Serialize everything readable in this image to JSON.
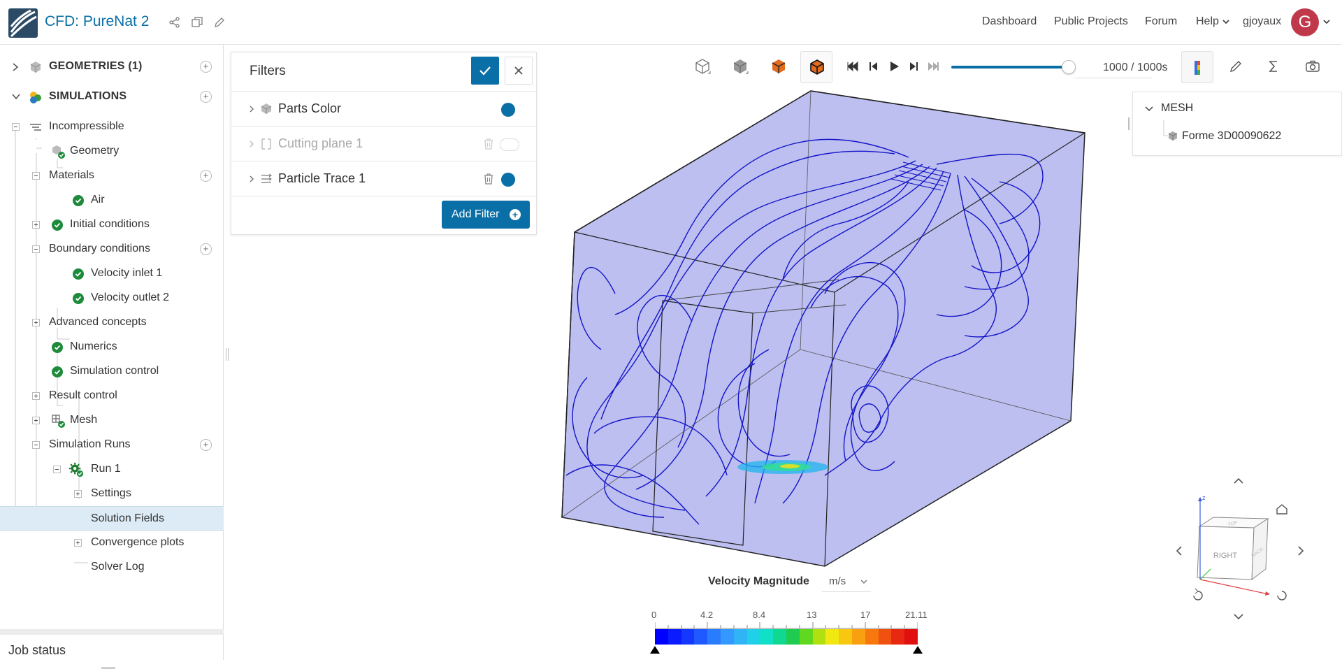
{
  "app": {
    "title": "CFD: PureNat 2",
    "nav": [
      "Dashboard",
      "Public Projects",
      "Forum",
      "Help",
      "gjoyaux"
    ],
    "avatar_letter": "G",
    "accent_color": "#0a6fa6"
  },
  "tree": {
    "geometries": "GEOMETRIES (1)",
    "simulations": "SIMULATIONS",
    "items": [
      {
        "label": "Incompressible"
      },
      {
        "label": "Geometry"
      },
      {
        "label": "Materials"
      },
      {
        "label": "Air"
      },
      {
        "label": "Initial conditions"
      },
      {
        "label": "Boundary conditions"
      },
      {
        "label": "Velocity inlet 1"
      },
      {
        "label": "Velocity outlet 2"
      },
      {
        "label": "Advanced concepts"
      },
      {
        "label": "Numerics"
      },
      {
        "label": "Simulation control"
      },
      {
        "label": "Result control"
      },
      {
        "label": "Mesh"
      },
      {
        "label": "Simulation Runs"
      },
      {
        "label": "Run 1"
      },
      {
        "label": "Settings"
      },
      {
        "label": "Solution Fields"
      },
      {
        "label": "Convergence plots"
      },
      {
        "label": "Solver Log"
      }
    ],
    "selected": "Solution Fields"
  },
  "job_status": "Job status",
  "filters": {
    "title": "Filters",
    "rows": [
      {
        "label": "Parts Color",
        "enabled": true
      },
      {
        "label": "Cutting plane 1",
        "enabled": false
      },
      {
        "label": "Particle Trace 1",
        "enabled": true
      }
    ],
    "add_label": "Add Filter"
  },
  "toolbar": {
    "time_readout": "1000 / 1000s",
    "time_progress": 0.98
  },
  "mesh_panel": {
    "title": "MESH",
    "item": "Forme 3D00090622"
  },
  "legend": {
    "label": "Velocity Magnitude",
    "unit": "m/s",
    "ticks": [
      "0",
      "4.2",
      "8.4",
      "13",
      "17",
      "21.11"
    ],
    "colors": [
      "#0000ff",
      "#0a1cff",
      "#1438ff",
      "#1e5aff",
      "#2a7cff",
      "#3398ff",
      "#30b4f5",
      "#20d0e8",
      "#10e0c8",
      "#10d890",
      "#20cc50",
      "#60d820",
      "#b0e010",
      "#f0e810",
      "#f8c810",
      "#f8a010",
      "#f87810",
      "#f05010",
      "#e82810",
      "#e01010"
    ],
    "min": 0,
    "max": 21.11
  },
  "navcube": {
    "axis_z": "z",
    "face_front": "RIGHT",
    "face_side": "BACK",
    "face_top": "TOP"
  }
}
